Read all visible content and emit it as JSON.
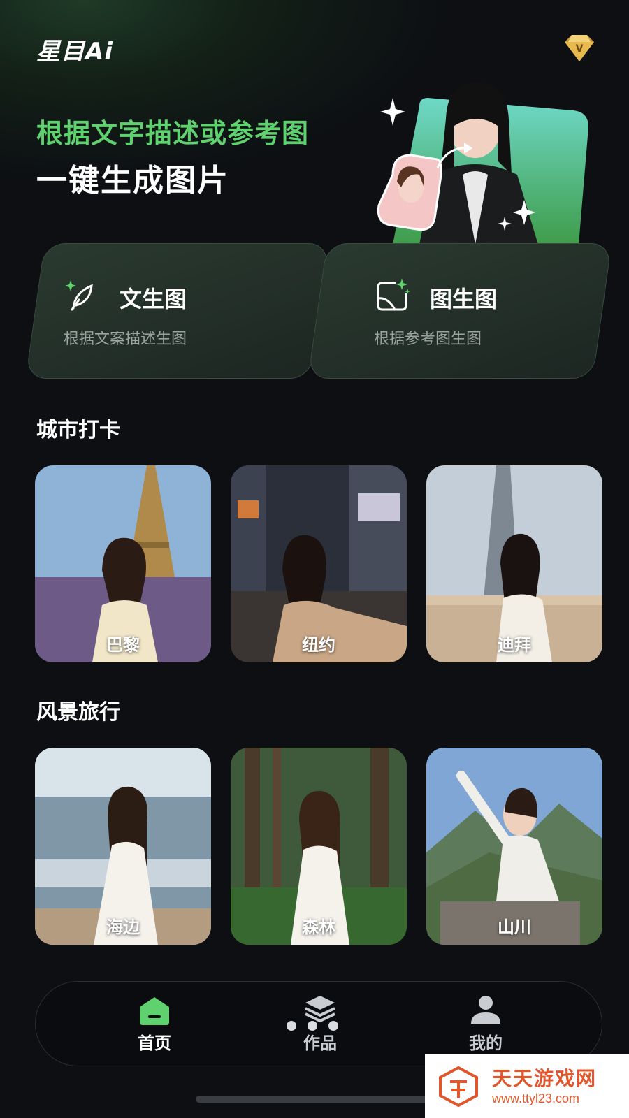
{
  "app": {
    "logo_text": "星目Ai"
  },
  "colors": {
    "accent": "#5fd26f",
    "background": "#0d0f13",
    "card": "#253029",
    "watermark": "#e3552b"
  },
  "hero": {
    "line1": "根据文字描述或参考图",
    "line2": "一键生成图片"
  },
  "features": [
    {
      "title": "文生图",
      "subtitle": "根据文案描述生图",
      "icon": "feather-sparkle-icon"
    },
    {
      "title": "图生图",
      "subtitle": "根据参考图生图",
      "icon": "image-sparkle-icon"
    }
  ],
  "sections": [
    {
      "title": "城市打卡",
      "items": [
        {
          "label": "巴黎"
        },
        {
          "label": "纽约"
        },
        {
          "label": "迪拜"
        }
      ]
    },
    {
      "title": "风景旅行",
      "items": [
        {
          "label": "海边"
        },
        {
          "label": "森林"
        },
        {
          "label": "山川"
        }
      ]
    }
  ],
  "tabbar": {
    "items": [
      {
        "label": "首页",
        "icon": "home-icon",
        "active": true
      },
      {
        "label": "作品",
        "icon": "layers-icon",
        "active": false
      },
      {
        "label": "我的",
        "icon": "user-icon",
        "active": false
      }
    ]
  },
  "watermark": {
    "title": "天天游戏网",
    "url": "www.ttyl23.com"
  }
}
